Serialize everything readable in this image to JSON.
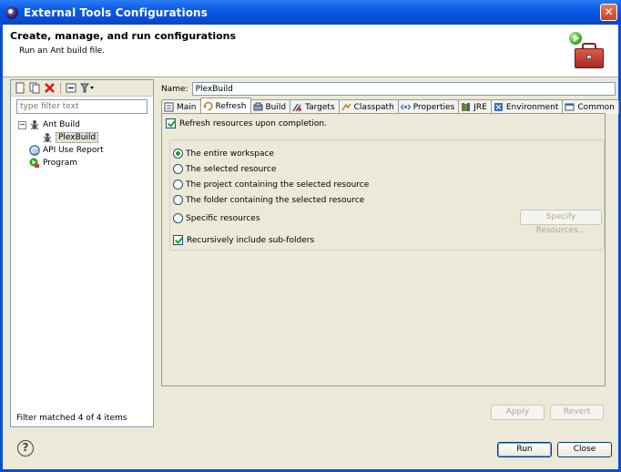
{
  "window": {
    "title": "External Tools Configurations",
    "close_label": "✕"
  },
  "header": {
    "heading": "Create, manage, and run configurations",
    "description": "Run an Ant build file."
  },
  "left": {
    "filter_placeholder": "type filter text",
    "tree": {
      "ant_build": "Ant Build",
      "plexbuild": "PlexBuild",
      "api_use_report": "API Use Report",
      "program": "Program"
    },
    "status": "Filter matched 4 of 4 items"
  },
  "editor": {
    "name_label": "Name:",
    "name_value": "PlexBuild",
    "tabs": {
      "main": "Main",
      "refresh": "Refresh",
      "build": "Build",
      "targets": "Targets",
      "classpath": "Classpath",
      "properties": "Properties",
      "jre": "JRE",
      "environment": "Environment",
      "common": "Common"
    },
    "refresh_checkbox": "Refresh resources upon completion.",
    "radios": {
      "entire_workspace": "The entire workspace",
      "selected_resource": "The selected resource",
      "project_resource": "The project containing the selected resource",
      "folder_resource": "The folder containing the selected resource",
      "specific_resources": "Specific resources"
    },
    "specify_resources_button": "Specify Resources...",
    "recursive_checkbox": "Recursively include sub-folders",
    "apply_button": "Apply",
    "revert_button": "Revert"
  },
  "footer": {
    "help_label": "?",
    "run_button": "Run",
    "close_button": "Close"
  }
}
